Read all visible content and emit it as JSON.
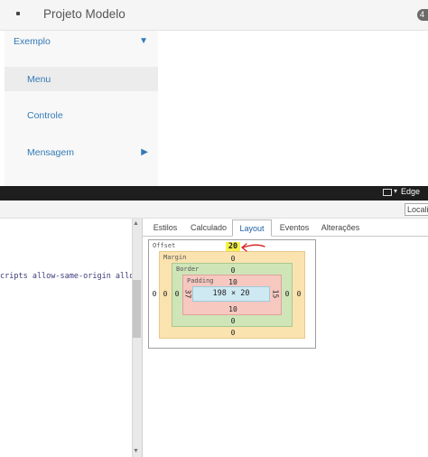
{
  "app": {
    "brand": "Projeto Modelo",
    "badge": "4",
    "sidebar": {
      "items": [
        {
          "label": "Exemplo",
          "arrow": "▼"
        },
        {
          "label": "Menu"
        },
        {
          "label": "Controle"
        },
        {
          "label": "Mensagem",
          "arrow": "▶"
        }
      ]
    }
  },
  "devtools": {
    "browser_mode": "Edge",
    "search_value": "Localiz",
    "code_snippet": "cripts allow-same-origin allow-",
    "tabs": [
      "Estilos",
      "Calculado",
      "Layout",
      "Eventos",
      "Alterações"
    ],
    "active_tab": "Layout",
    "box_model": {
      "offset_label": "Offset",
      "offset_top": "20",
      "offset_left": "0",
      "margin_label": "Margin",
      "margin_top": "0",
      "margin_left": "0",
      "margin_right": "0",
      "margin_bottom": "0",
      "border_label": "Border",
      "border_top": "0",
      "border_left": "0",
      "border_right": "0",
      "border_bottom": "0",
      "padding_label": "Padding",
      "padding_top": "10",
      "padding_left": "37",
      "padding_right": "15",
      "padding_bottom": "10",
      "content_size": "198 × 20"
    }
  },
  "colors": {
    "link": "#337ab7",
    "margin": "#fbe3b0",
    "border": "#cfe5b8",
    "padding": "#f6c8c0",
    "content": "#cfe9f3",
    "highlight": "#f5f24a",
    "annotation": "#d62828"
  }
}
